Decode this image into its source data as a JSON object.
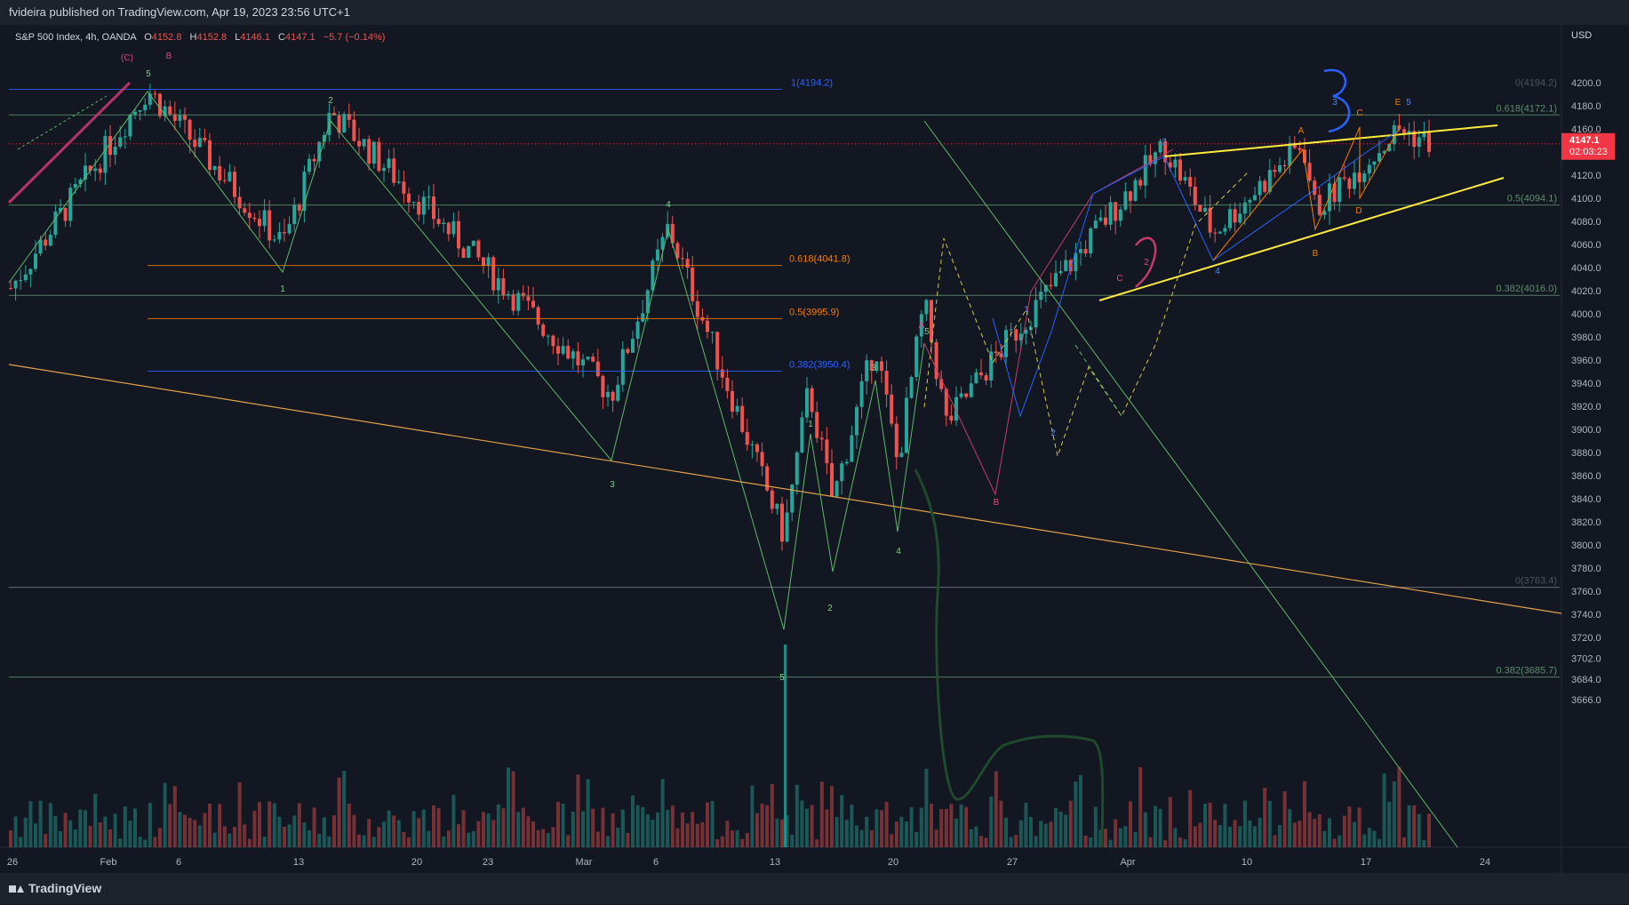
{
  "header": {
    "published": "fvideira published on TradingView.com, Apr 19, 2023 23:56 UTC+1"
  },
  "legend": {
    "symbol": "S&P 500 Index, 4h, OANDA",
    "open_label": "O",
    "open": "4152.8",
    "high_label": "H",
    "high": "4152.8",
    "low_label": "L",
    "low": "4146.1",
    "close_label": "C",
    "close": "4147.1",
    "change": "−5.7 (−0.14%)"
  },
  "footer": {
    "brand": "TradingView"
  },
  "colors": {
    "background": "#131722",
    "up": "#26a69a",
    "down": "#ef5350",
    "price_tag": "#f23645",
    "fib_green": "#5b8f6a",
    "fib_orange": "#f57c00",
    "fib_blue": "#2962ff",
    "wedge": "#ffeb3b"
  },
  "chart_data": {
    "type": "candlestick",
    "currency": "USD",
    "current_price": "4147.1",
    "countdown": "02:03:23",
    "y_ticks": [
      "4200.0",
      "4180.0",
      "4160.0",
      "4140.0",
      "4120.0",
      "4100.0",
      "4080.0",
      "4060.0",
      "4040.0",
      "4020.0",
      "4000.0",
      "3980.0",
      "3960.0",
      "3940.0",
      "3920.0",
      "3900.0",
      "3880.0",
      "3860.0",
      "3840.0",
      "3820.0",
      "3800.0",
      "3780.0",
      "3760.0",
      "3740.0",
      "3720.0",
      "3702.0",
      "3684.0",
      "3666.0"
    ],
    "x_ticks": [
      "26",
      "Feb",
      "6",
      "13",
      "20",
      "23",
      "Mar",
      "6",
      "13",
      "20",
      "27",
      "Apr",
      "10",
      "17",
      "24"
    ],
    "ohlc_keypoints": [
      [
        "Jan 26",
        4020
      ],
      [
        "Feb 2",
        4194.2
      ],
      [
        "Feb 10",
        4060
      ],
      [
        "Feb 14",
        4175
      ],
      [
        "Mar 2",
        3930
      ],
      [
        "Mar 7",
        4075
      ],
      [
        "Mar 13",
        3808
      ],
      [
        "Mar 14",
        3935
      ],
      [
        "Mar 16",
        3838
      ],
      [
        "Mar 20",
        3975
      ],
      [
        "Mar 21",
        3870
      ],
      [
        "Mar 23",
        4010
      ],
      [
        "Mar 24",
        3905
      ],
      [
        "Mar 28",
        3960
      ],
      [
        "Apr 3",
        4145
      ],
      [
        "Apr 5",
        4070
      ],
      [
        "Apr 12",
        4148
      ],
      [
        "Apr 14",
        4090
      ],
      [
        "Apr 18",
        4160
      ],
      [
        "Apr 19",
        4147.1
      ]
    ],
    "fib_levels": [
      {
        "label": "1(4194.2)",
        "price": 4194.2,
        "color": "blue"
      },
      {
        "label": "0.618(4041.8)",
        "price": 4041.8,
        "color": "orange"
      },
      {
        "label": "0.5(3995.9)",
        "price": 3995.9,
        "color": "orange"
      },
      {
        "label": "0.382(3950.4)",
        "price": 3950.4,
        "color": "blue"
      },
      {
        "label": "0(4194.2)",
        "price": 4194.2,
        "color": "gray"
      },
      {
        "label": "0.618(4172.1)",
        "price": 4172.1,
        "color": "green"
      },
      {
        "label": "0.5(4094.1)",
        "price": 4094.1,
        "color": "green"
      },
      {
        "label": "0.382(4016.0)",
        "price": 4016.0,
        "color": "green"
      },
      {
        "label": "0(3763.4)",
        "price": 3763.4,
        "color": "gray"
      },
      {
        "label": "0.382(3685.7)",
        "price": 3685.7,
        "color": "green"
      }
    ],
    "wave_labels": [
      {
        "text": "(C)",
        "color": "pink"
      },
      {
        "text": "B",
        "color": "pink"
      },
      {
        "text": "5",
        "color": "green"
      },
      {
        "text": "2",
        "color": "green"
      },
      {
        "text": "1",
        "color": "green"
      },
      {
        "text": "3",
        "color": "green"
      },
      {
        "text": "4",
        "color": "green"
      },
      {
        "text": "5",
        "color": "green"
      },
      {
        "text": "1",
        "color": "green"
      },
      {
        "text": "2",
        "color": "green"
      },
      {
        "text": "3",
        "color": "green"
      },
      {
        "text": "4",
        "color": "green"
      },
      {
        "text": "5",
        "color": "green"
      },
      {
        "text": "A",
        "color": "pink"
      },
      {
        "text": "B",
        "color": "pink"
      },
      {
        "text": "C",
        "color": "pink"
      },
      {
        "text": "1",
        "color": "blue"
      },
      {
        "text": "2",
        "color": "blue"
      },
      {
        "text": "3",
        "color": "blue"
      },
      {
        "text": "4",
        "color": "blue"
      },
      {
        "text": "5",
        "color": "blue"
      },
      {
        "text": "A",
        "color": "orange"
      },
      {
        "text": "B",
        "color": "orange"
      },
      {
        "text": "C",
        "color": "orange"
      },
      {
        "text": "D",
        "color": "orange"
      },
      {
        "text": "E",
        "color": "orange"
      },
      {
        "text": "3",
        "color": "blue"
      },
      {
        "text": "2",
        "color": "pink"
      }
    ]
  }
}
